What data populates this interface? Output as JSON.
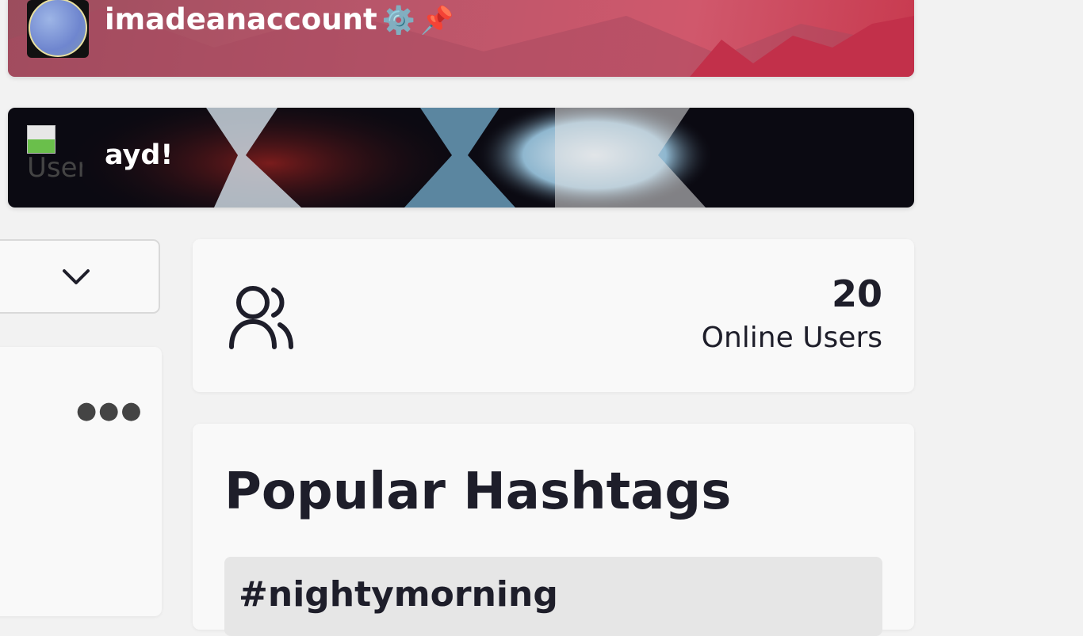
{
  "user_cards": [
    {
      "username": "imadeanaccount",
      "badges": [
        "⚙️",
        "📌"
      ]
    },
    {
      "username": "ayd!",
      "avatar_alt": "User"
    }
  ],
  "online_users": {
    "count": "20",
    "label": "Online Users"
  },
  "popular_hashtags": {
    "title": "Popular Hashtags",
    "tags": [
      "#nightymorning"
    ]
  },
  "icons": {
    "users": "users-icon",
    "dropdown": "chevron-down-icon",
    "more": "more-options-icon"
  }
}
